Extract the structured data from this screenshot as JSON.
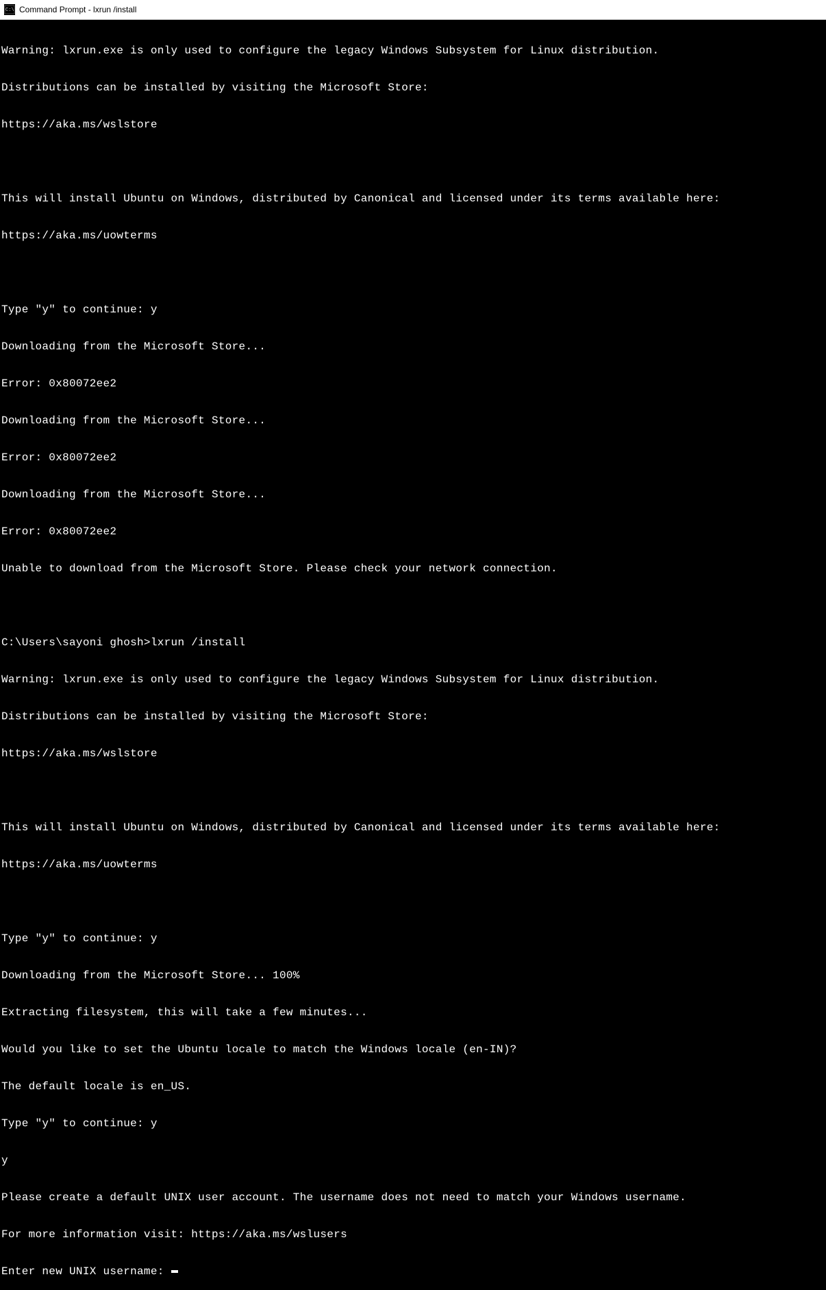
{
  "window": {
    "title": "Command Prompt - lxrun  /install"
  },
  "terminal": {
    "lines": [
      "Warning: lxrun.exe is only used to configure the legacy Windows Subsystem for Linux distribution.",
      "Distributions can be installed by visiting the Microsoft Store:",
      "https://aka.ms/wslstore",
      "",
      "This will install Ubuntu on Windows, distributed by Canonical and licensed under its terms available here:",
      "https://aka.ms/uowterms",
      "",
      "Type \"y\" to continue: y",
      "Downloading from the Microsoft Store...",
      "Error: 0x80072ee2",
      "Downloading from the Microsoft Store...",
      "Error: 0x80072ee2",
      "Downloading from the Microsoft Store...",
      "Error: 0x80072ee2",
      "Unable to download from the Microsoft Store. Please check your network connection.",
      "",
      "C:\\Users\\sayoni ghosh>lxrun /install",
      "Warning: lxrun.exe is only used to configure the legacy Windows Subsystem for Linux distribution.",
      "Distributions can be installed by visiting the Microsoft Store:",
      "https://aka.ms/wslstore",
      "",
      "This will install Ubuntu on Windows, distributed by Canonical and licensed under its terms available here:",
      "https://aka.ms/uowterms",
      "",
      "Type \"y\" to continue: y",
      "Downloading from the Microsoft Store... 100%",
      "Extracting filesystem, this will take a few minutes...",
      "Would you like to set the Ubuntu locale to match the Windows locale (en-IN)?",
      "The default locale is en_US.",
      "Type \"y\" to continue: y",
      "y",
      "Please create a default UNIX user account. The username does not need to match your Windows username.",
      "For more information visit: https://aka.ms/wslusers"
    ],
    "prompt": "Enter new UNIX username: "
  }
}
